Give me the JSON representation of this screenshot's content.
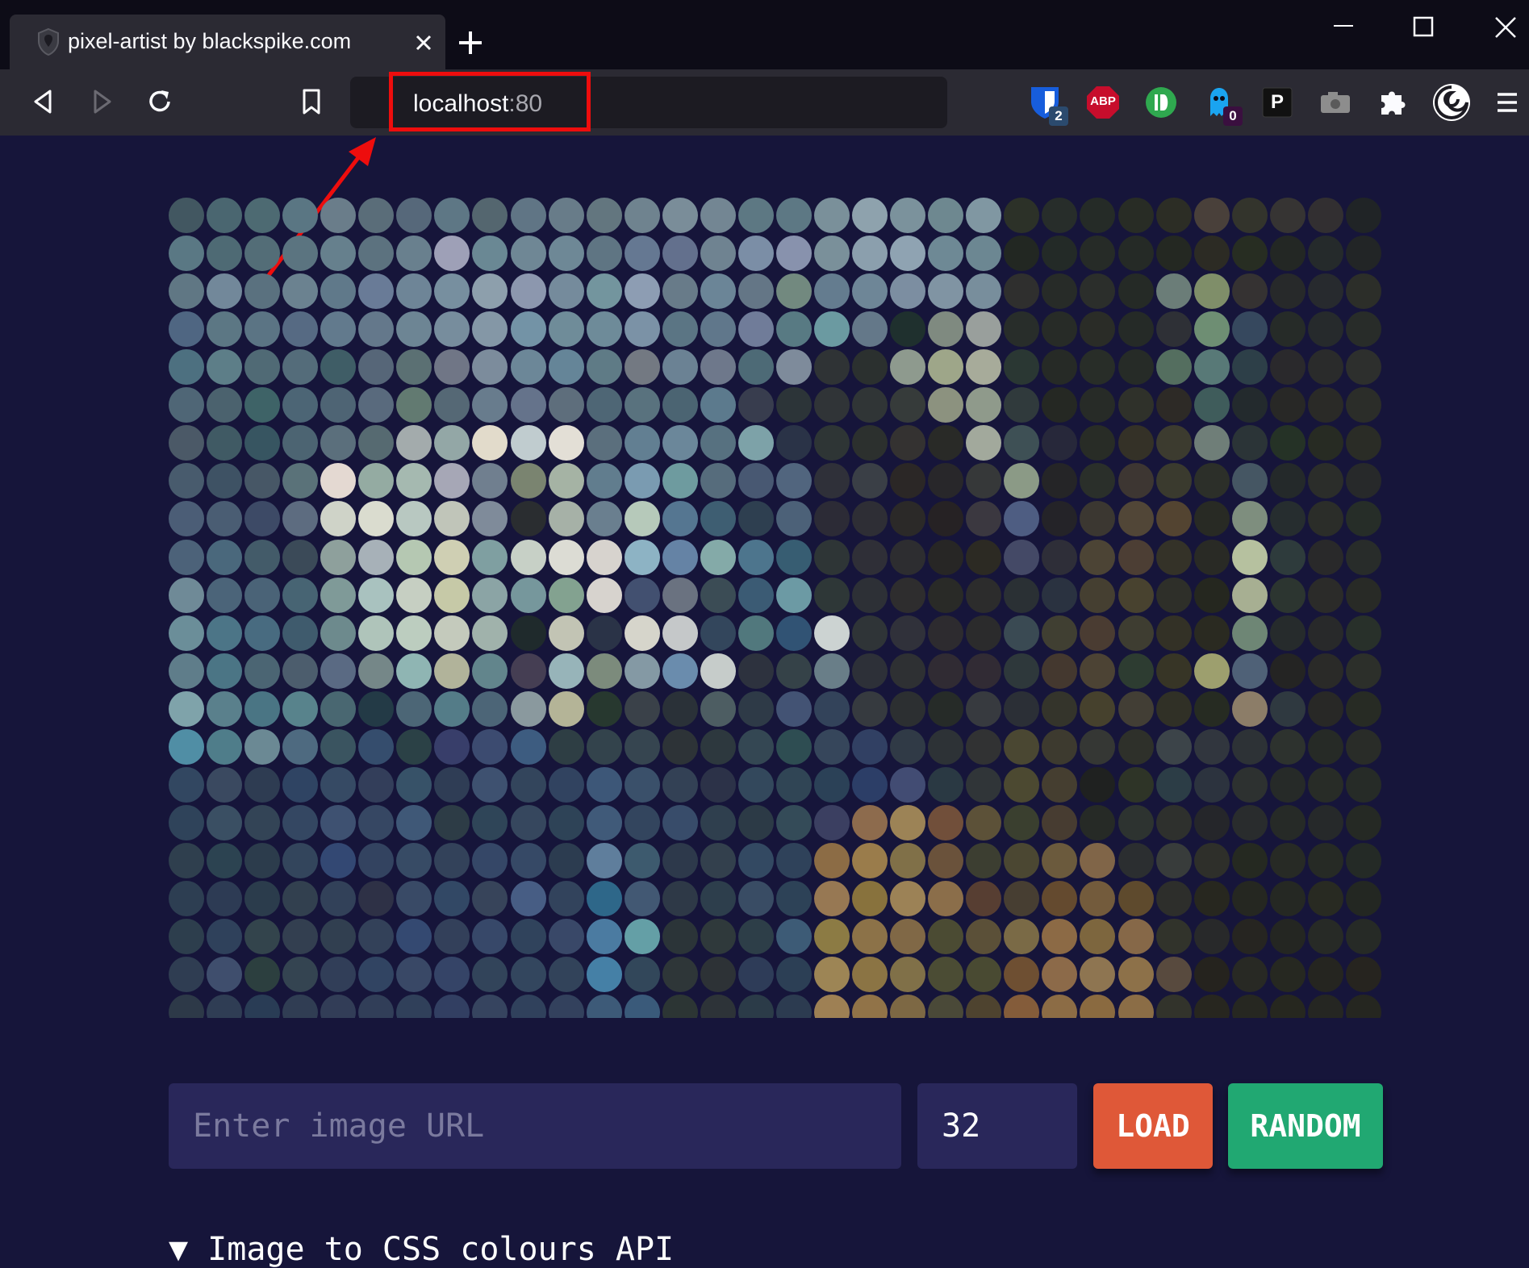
{
  "browser": {
    "tab_title": "pixel-artist by blackspike.com",
    "url_host": "localhost",
    "url_port": ":80",
    "extensions": [
      {
        "name": "bitwarden-icon",
        "badge": "2",
        "color": "#175ddc",
        "badge_color": "#2b4a6e"
      },
      {
        "name": "adblock-plus-icon",
        "label": "ABP",
        "color": "#c70d2c"
      },
      {
        "name": "ublock-icon",
        "color": "#2fa84f"
      },
      {
        "name": "ghostery-icon",
        "badge": "0",
        "color": "#1aa4f0",
        "badge_color": "#3a0f3f"
      },
      {
        "name": "p-extension-icon",
        "label": "P",
        "color": "#111111"
      },
      {
        "name": "camera-extension-icon",
        "color": "#8d8d8d"
      },
      {
        "name": "extensions-puzzle-icon",
        "color": "#fbfbfe"
      },
      {
        "name": "profile-icon",
        "color": "#ffffff"
      },
      {
        "name": "menu-icon",
        "color": "#fbfbfe"
      }
    ]
  },
  "app": {
    "url_placeholder": "Enter image URL",
    "size_value": "32",
    "load_label": "LOAD",
    "random_label": "RANDOM",
    "details_label": "▼ Image to CSS colours API"
  },
  "colors": {
    "page_bg": "#16153a",
    "load_button": "#df5838",
    "random_button": "#21a872",
    "annotation": "#ee0d0d"
  },
  "pixel_grid": {
    "cols": 32,
    "rows": 22,
    "rows_data": [
      [
        "#425761",
        "#4a6670",
        "#4d6a72",
        "#5a7683",
        "#6a7d8a",
        "#5a6d79",
        "#56687a",
        "#5e7785",
        "#54666f",
        "#607585",
        "#687c89",
        "#63767f",
        "#6f838f",
        "#7a8d99",
        "#738693",
        "#5d7883",
        "#5d7884",
        "#7a909a",
        "#8ea2ad",
        "#7b929c",
        "#6e8890",
        "#8097a2",
        "#2c3128",
        "#272d2a",
        "#252b27",
        "#282c25",
        "#2c2d25",
        "#49403a",
        "#33342c",
        "#363433",
        "#322f31",
        "#202426"
      ],
      [
        "#5a7884",
        "#4e6a74",
        "#536d77",
        "#5b7480",
        "#66808d",
        "#5c727f",
        "#69808e",
        "#9ea0b7",
        "#6a8894",
        "#6f8795",
        "#6e8896",
        "#5f7583",
        "#657892",
        "#63708d",
        "#6f8391",
        "#7b8ea6",
        "#8892ad",
        "#7a909a",
        "#8b9fad",
        "#8fa3b2",
        "#6e8995",
        "#6c8792",
        "#222722",
        "#232a27",
        "#262b27",
        "#252a26",
        "#242822",
        "#2c2b24",
        "#272d22",
        "#232724",
        "#252a2b",
        "#222526"
      ],
      [
        "#607784",
        "#72889a",
        "#5a717f",
        "#6b8290",
        "#60798a",
        "#697b97",
        "#6e8597",
        "#778f9f",
        "#8d9fac",
        "#8c97ae",
        "#758b9c",
        "#73959e",
        "#8d9db3",
        "#687b89",
        "#6b8597",
        "#647686",
        "#72897f",
        "#647c8f",
        "#6e8697",
        "#7c8ea1",
        "#8094a3",
        "#788e9c",
        "#2f2f2e",
        "#272b28",
        "#2b2e2b",
        "#252a26",
        "#6b7d78",
        "#7f8e69",
        "#353232",
        "#27292a",
        "#272a2e",
        "#2c2e29"
      ],
      [
        "#4f6682",
        "#5c7784",
        "#5b7484",
        "#566a83",
        "#627a8d",
        "#64788b",
        "#6d8594",
        "#778d9d",
        "#8497a6",
        "#7393a6",
        "#6f8c99",
        "#6e8b99",
        "#7b92a6",
        "#5b7584",
        "#60778b",
        "#707c99",
        "#587a83",
        "#6b9aa1",
        "#647889",
        "#1f302e",
        "#7f8a80",
        "#999f9c",
        "#282d2a",
        "#272b27",
        "#2a2c27",
        "#252a27",
        "#2e3036",
        "#6e8e73",
        "#36485e",
        "#262b28",
        "#262a2c",
        "#282c29"
      ],
      [
        "#4d7080",
        "#5d7e88",
        "#506a75",
        "#546c7a",
        "#3f5d66",
        "#566678",
        "#5b7073",
        "#707686",
        "#7c8c9c",
        "#6c8798",
        "#658598",
        "#5f7b86",
        "#737982",
        "#6b8294",
        "#6e788b",
        "#4d6a76",
        "#7e8b9b",
        "#2f3335",
        "#2b302f",
        "#8e9a8e",
        "#9ea689",
        "#a7ab9a",
        "#2a3733",
        "#262a26",
        "#282d28",
        "#262b27",
        "#546e5f",
        "#587977",
        "#2d3f48",
        "#2a292c",
        "#2a2b2b",
        "#2d2f2d"
      ],
      [
        "#4f6676",
        "#4b626e",
        "#3e6367",
        "#4c6575",
        "#4e6474",
        "#596a7d",
        "#627a71",
        "#556875",
        "#687c8d",
        "#65738b",
        "#5e6e7c",
        "#4e6675",
        "#59727e",
        "#4b6472",
        "#5c7a8d",
        "#383d4e",
        "#2c3438",
        "#303437",
        "#303536",
        "#363b3a",
        "#8c927f",
        "#8f9a8b",
        "#303a3c",
        "#252823",
        "#272b27",
        "#2f312a",
        "#2d2a26",
        "#3f5c5b",
        "#232a2d",
        "#282826",
        "#2a2a27",
        "#2b2d29"
      ],
      [
        "#4b5967",
        "#405a64",
        "#375561",
        "#4c6472",
        "#5b6f7c",
        "#566a71",
        "#a3abac",
        "#93a7a6",
        "#e2dbcb",
        "#c0cccf",
        "#e3dfd6",
        "#5b6f7d",
        "#627f92",
        "#6b879a",
        "#577180",
        "#7da2a8",
        "#2a3347",
        "#2e3535",
        "#2c302e",
        "#343231",
        "#292a27",
        "#a2a99c",
        "#3e5055",
        "#27283a",
        "#282c26",
        "#343127",
        "#3c3b2f",
        "#6f7e78",
        "#2b3437",
        "#253226",
        "#272b23",
        "#2a2c26"
      ],
      [
        "#485b6d",
        "#3e5264",
        "#475766",
        "#5a7279",
        "#e4d9d2",
        "#94aba2",
        "#a5b9b0",
        "#a6a7b6",
        "#707f8f",
        "#7a8470",
        "#a5b3a4",
        "#617d8e",
        "#7a9bb1",
        "#6e9b9f",
        "#566c7c",
        "#485872",
        "#51657e",
        "#2f3039",
        "#3a3f46",
        "#2b2726",
        "#28272a",
        "#363839",
        "#8b9a86",
        "#252527",
        "#2a2f2a",
        "#3d3632",
        "#3a3a2e",
        "#2c2f29",
        "#455663",
        "#24292a",
        "#2b2d2a",
        "#27292a"
      ],
      [
        "#4b5d76",
        "#4a5d73",
        "#3d4a66",
        "#5d6c80",
        "#cfd3c8",
        "#dadccf",
        "#b8c8c1",
        "#c0c5b9",
        "#7f8b9a",
        "#2a2d30",
        "#a6b1a7",
        "#6a7f8f",
        "#b6c9ba",
        "#557691",
        "#3e5e72",
        "#2e3f50",
        "#4c6178",
        "#2c2b36",
        "#2e2e35",
        "#2b2928",
        "#262224",
        "#3b3840",
        "#4e5d82",
        "#242328",
        "#3b3731",
        "#514637",
        "#534431",
        "#282a24",
        "#7e8e7e",
        "#262d2f",
        "#2b2d29",
        "#262d28"
      ],
      [
        "#4c6279",
        "#4a687c",
        "#435b69",
        "#3b4a58",
        "#8ea09c",
        "#a7b1b8",
        "#b5c8b2",
        "#cfcfb3",
        "#7f9fa1",
        "#c7d0c6",
        "#dcdcd4",
        "#d7d3ce",
        "#8db3c4",
        "#6583a5",
        "#84aaa8",
        "#4d758d",
        "#375d72",
        "#2e3536",
        "#2f2f37",
        "#2d2d30",
        "#272625",
        "#2c2a23",
        "#444966",
        "#2e2e38",
        "#4c4435",
        "#4c3e34",
        "#343228",
        "#292a25",
        "#b6c19f",
        "#2e3b3c",
        "#29292a",
        "#282c2a"
      ],
      [
        "#6f8a97",
        "#4b6479",
        "#4a6377",
        "#476473",
        "#7f9a98",
        "#a9c2bf",
        "#c6cfc2",
        "#c6c9a7",
        "#8ba4a5",
        "#76979c",
        "#83a290",
        "#d7d3ce",
        "#425070",
        "#6a7280",
        "#3b4c55",
        "#3b5b74",
        "#6c9aa4",
        "#2e3737",
        "#2d3036",
        "#2e2d2e",
        "#292a27",
        "#2c2c2c",
        "#2a3034",
        "#2a3240",
        "#453f31",
        "#48422f",
        "#2e2f29",
        "#25271f",
        "#a7af92",
        "#2c3530",
        "#2b2b29",
        "#282a26"
      ],
      [
        "#6b8e99",
        "#4c7587",
        "#486b80",
        "#3f5b6d",
        "#6d8a8d",
        "#afc4ba",
        "#bccdbf",
        "#c4cabc",
        "#a0b2ab",
        "#1f2a2c",
        "#c2c4b4",
        "#2a3347",
        "#d6d5cb",
        "#c5c8c9",
        "#33465c",
        "#51787d",
        "#315374",
        "#ccd3d2",
        "#2f3437",
        "#30313a",
        "#2d2b2f",
        "#2b2b2c",
        "#3a4a53",
        "#403f32",
        "#4a3c32",
        "#3e3d31",
        "#333126",
        "#2a2a21",
        "#6e8675",
        "#262b2c",
        "#28292a",
        "#28302a"
      ],
      [
        "#5f7d8a",
        "#4b7585",
        "#4b6573",
        "#4c5d6d",
        "#5a6a83",
        "#758788",
        "#8fb5b3",
        "#b1b39a",
        "#62858c",
        "#453e53",
        "#97b4b9",
        "#7c8b7c",
        "#8499a4",
        "#6a8cad",
        "#c6ccca",
        "#2d323e",
        "#354248",
        "#697e88",
        "#2d3038",
        "#2e3033",
        "#302b33",
        "#312b34",
        "#2e383b",
        "#44382f",
        "#4c4334",
        "#2d3c31",
        "#373526",
        "#9d9f6e",
        "#4f6177",
        "#242423",
        "#2a2a28",
        "#2c2f2a"
      ],
      [
        "#7fa3aa",
        "#5a808c",
        "#4a7584",
        "#58838c",
        "#496771",
        "#233a46",
        "#4c6676",
        "#547c88",
        "#4c6577",
        "#8a999e",
        "#b4b497",
        "#27382f",
        "#3a4149",
        "#2a3138",
        "#4d5d62",
        "#2e3a47",
        "#435374",
        "#33435a",
        "#363a3f",
        "#2c2f31",
        "#262b28",
        "#373a3f",
        "#2b2f36",
        "#34342b",
        "#46412d",
        "#423e35",
        "#303026",
        "#262b22",
        "#8c7d68",
        "#2f3940",
        "#282826",
        "#272b24"
      ],
      [
        "#508ea5",
        "#4f7d8a",
        "#6b8994",
        "#4e6a80",
        "#3a5460",
        "#354d6d",
        "#2b4146",
        "#383e6a",
        "#3c4b70",
        "#3d5c80",
        "#2e3e44",
        "#33434c",
        "#364550",
        "#2d3337",
        "#2d383e",
        "#344753",
        "#2e4d52",
        "#36465b",
        "#314063",
        "#303a46",
        "#2d3236",
        "#313233",
        "#4a4732",
        "#3d3a2f",
        "#353734",
        "#2e302a",
        "#3c4449",
        "#31363e",
        "#2d3236",
        "#2d322e",
        "#262a26",
        "#292c28"
      ],
      [
        "#324761",
        "#3a4960",
        "#2e3c52",
        "#2f4463",
        "#364a64",
        "#333e5a",
        "#375268",
        "#2f3d55",
        "#3e5170",
        "#33455c",
        "#314360",
        "#3d5778",
        "#3a506a",
        "#334155",
        "#2c3248",
        "#33485c",
        "#304555",
        "#2b4157",
        "#2c3e67",
        "#424c73",
        "#2a3943",
        "#303538",
        "#4c4931",
        "#453e30",
        "#1f2120",
        "#2e3427",
        "#2c3d46",
        "#2c333e",
        "#2d3130",
        "#262a28",
        "#282c27",
        "#262b27"
      ],
      [
        "#2f435a",
        "#3a4f63",
        "#334456",
        "#344762",
        "#3e5171",
        "#364763",
        "#3f5877",
        "#2d3c46",
        "#2f4558",
        "#36475e",
        "#2e4357",
        "#405a79",
        "#33455e",
        "#384c6a",
        "#2f3f4e",
        "#2c3a46",
        "#344b58",
        "#3b3f61",
        "#8d6b4d",
        "#9c8356",
        "#714f3a",
        "#5c5138",
        "#3a3f2f",
        "#473c31",
        "#262a26",
        "#2d3330",
        "#2e302d",
        "#25262a",
        "#292c2d",
        "#262a27",
        "#26292a",
        "#252924"
      ],
      [
        "#2f3f4e",
        "#2c4351",
        "#2c3c4c",
        "#33455c",
        "#334873",
        "#334360",
        "#374b65",
        "#33425a",
        "#354767",
        "#364966",
        "#2c3c50",
        "#5f7e9c",
        "#3d5a6e",
        "#2d394b",
        "#33404d",
        "#334962",
        "#2f425a",
        "#8c6c45",
        "#9a7c4b",
        "#807048",
        "#6a523b",
        "#3c3e31",
        "#4b4732",
        "#6b5a3d",
        "#806548",
        "#2b2e30",
        "#383c3b",
        "#2e2f2a",
        "#252921",
        "#272a25",
        "#262a25",
        "#242a26"
      ],
      [
        "#2d3e52",
        "#2d3b54",
        "#2b3c4c",
        "#32404f",
        "#324159",
        "#2e3146",
        "#394a66",
        "#324865",
        "#37445a",
        "#475d84",
        "#32435c",
        "#2e6789",
        "#425873",
        "#2e3947",
        "#2d3e4c",
        "#394c64",
        "#2d4257",
        "#977853",
        "#88723d",
        "#9c8256",
        "#8b6e4a",
        "#573e32",
        "#473e32",
        "#644a2f",
        "#735b3c",
        "#5e4a2d",
        "#2d2e2b",
        "#27271f",
        "#252721",
        "#252823",
        "#282a22",
        "#232722"
      ],
      [
        "#2d3e4d",
        "#2f415b",
        "#33444c",
        "#333f50",
        "#313f50",
        "#334159",
        "#344971",
        "#33405a",
        "#374869",
        "#30435c",
        "#394868",
        "#4b7ba1",
        "#649fa6",
        "#2b3438",
        "#2f393b",
        "#2d3e48",
        "#3d5b76",
        "#8c7b44",
        "#8c7248",
        "#806846",
        "#4b4b33",
        "#5b5038",
        "#7a6a46",
        "#8c6a45",
        "#7d663e",
        "#866848",
        "#31332b",
        "#28292a",
        "#262521",
        "#242622",
        "#272a26",
        "#262a26"
      ],
      [
        "#2f3d52",
        "#3f4e6d",
        "#2c3f3f",
        "#344451",
        "#313e58",
        "#314462",
        "#394866",
        "#354467",
        "#32445a",
        "#33465e",
        "#32435a",
        "#4580a6",
        "#32475a",
        "#2e3638",
        "#2d3236",
        "#2e3c58",
        "#2c3f55",
        "#9d8555",
        "#8b7444",
        "#807048",
        "#4b4c34",
        "#494a32",
        "#6e4f32",
        "#8c6a49",
        "#8e7551",
        "#8d7149",
        "#584a3e",
        "#25231e",
        "#282924",
        "#262821",
        "#252520",
        "#26241f"
      ],
      [
        "#2d3948",
        "#2f3d54",
        "#293c55",
        "#303d53",
        "#323d57",
        "#313e58",
        "#30405a",
        "#323f62",
        "#36445f",
        "#30415c",
        "#33415d",
        "#3d5a78",
        "#3a5a7a",
        "#2c3534",
        "#2d3338",
        "#2b3b48",
        "#2c3b50",
        "#9e8054",
        "#917348",
        "#7d6844",
        "#4a4938",
        "#4e432f",
        "#845c3a",
        "#8c6c45",
        "#8a6a40",
        "#8b6d46",
        "#32332b",
        "#27261f",
        "#262721",
        "#26271f",
        "#252622",
        "#252620"
      ]
    ]
  }
}
